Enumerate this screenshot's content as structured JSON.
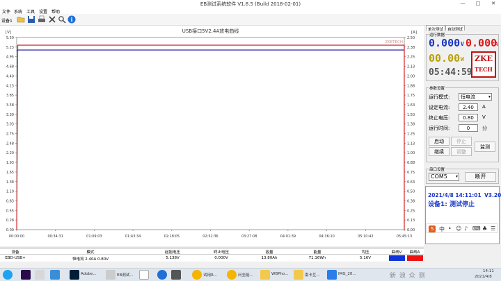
{
  "window": {
    "title": "EB测试系统软件 V1.8.5 (Build 2018-02-01)",
    "minimize": "—",
    "maximize": "□",
    "close": "✕"
  },
  "menu": [
    "文件",
    "系统",
    "工具",
    "设置",
    "帮助"
  ],
  "toolbar": {
    "device_label": "设备1"
  },
  "tabs": [
    "单次测试",
    "自动测试"
  ],
  "chart_data": {
    "type": "line",
    "title": "USB接口5V2.4A放电曲线",
    "watermark": "ZKETECH",
    "left_unit": "[V]",
    "right_unit": "[A]",
    "x_ticks": [
      "00:00:00",
      "00:34:31",
      "01:09:03",
      "01:43:34",
      "02:18:05",
      "02:52:36",
      "03:27:08",
      "04:01:39",
      "04:36:10",
      "05:10:42",
      "05:45:13"
    ],
    "y_left_ticks": [
      "0.00",
      "0.28",
      "0.55",
      "0.83",
      "1.10",
      "1.38",
      "1.65",
      "1.93",
      "2.20",
      "2.48",
      "2.75",
      "3.03",
      "3.30",
      "3.58",
      "3.85",
      "4.13",
      "4.40",
      "4.68",
      "4.95",
      "5.23",
      "5.50"
    ],
    "y_right_ticks": [
      "0.00",
      "0.13",
      "0.25",
      "0.38",
      "0.50",
      "0.63",
      "0.75",
      "0.88",
      "1.00",
      "1.13",
      "1.25",
      "1.38",
      "1.50",
      "1.63",
      "1.75",
      "1.88",
      "2.00",
      "2.13",
      "2.25",
      "2.38",
      "2.50"
    ],
    "ylim_left": [
      0,
      5.5
    ],
    "ylim_right": [
      0,
      2.5
    ],
    "xlim_minutes": [
      0,
      345.2
    ],
    "series": [
      {
        "name": "曲线V",
        "axis": "left",
        "color": "#1010a0",
        "x_minutes": [
          0,
          1,
          2,
          345.2
        ],
        "y": [
          5.13,
          5.14,
          5.14,
          5.14
        ]
      },
      {
        "name": "曲线A",
        "axis": "right",
        "color": "#d01010",
        "x_minutes": [
          0,
          1,
          1.5,
          344.5,
          345.2,
          345.2
        ],
        "y": [
          0,
          2.4,
          2.4,
          2.4,
          2.4,
          0
        ]
      }
    ]
  },
  "panel": {
    "realtime_title": "运行数据",
    "voltage": "0.000",
    "voltage_unit": "V",
    "current": "0.000",
    "current_unit": "A",
    "power": "00.00",
    "power_unit": "W",
    "time": "05:44:59",
    "logo_top": "ZKE",
    "logo_bottom": "TECH",
    "params_title": "参数设置",
    "mode_label": "运行模式:",
    "mode_value": "恒电流",
    "set_current_label": "设定电流:",
    "set_current_value": "2.40",
    "set_current_unit": "A",
    "end_voltage_label": "终止电压:",
    "end_voltage_value": "0.80",
    "end_voltage_unit": "V",
    "run_time_label": "运行时间:",
    "run_time_value": "0",
    "run_time_unit": "分",
    "btn_start": "启动",
    "btn_stop": "停止",
    "btn_continue": "继续",
    "btn_adjust": "调整",
    "btn_monitor": "监测",
    "port_title": "串口设置",
    "port_value": "COM5",
    "btn_disconnect": "断开",
    "status_line1": "2021/4/8 14:11:01",
    "status_version": "V3.20",
    "status_line2": "设备1: 测试停止"
  },
  "table": {
    "headers": [
      "设备",
      "模式",
      "起始电压",
      "终止电压",
      "容量",
      "能量",
      "均压",
      "曲线V",
      "曲线A"
    ],
    "row": [
      "EBD-USB+",
      "恒电流 2.40A 0.80V",
      "5.138V",
      "0.000V",
      "13.80Ah",
      "71.16Wh",
      "5.16V",
      "",
      ""
    ],
    "colors": {
      "curve_v": "#1133dd",
      "curve_a": "#ee1111"
    }
  },
  "taskbar": {
    "items": [
      "Adobe...",
      "EB测试...",
      "试用R...",
      "问全能...",
      "WBPho...",
      "南卡互...",
      "IMG_20..."
    ],
    "clock_time": "14:11",
    "clock_date": "2021/4/8",
    "watermark": "新 浪 众 测"
  }
}
